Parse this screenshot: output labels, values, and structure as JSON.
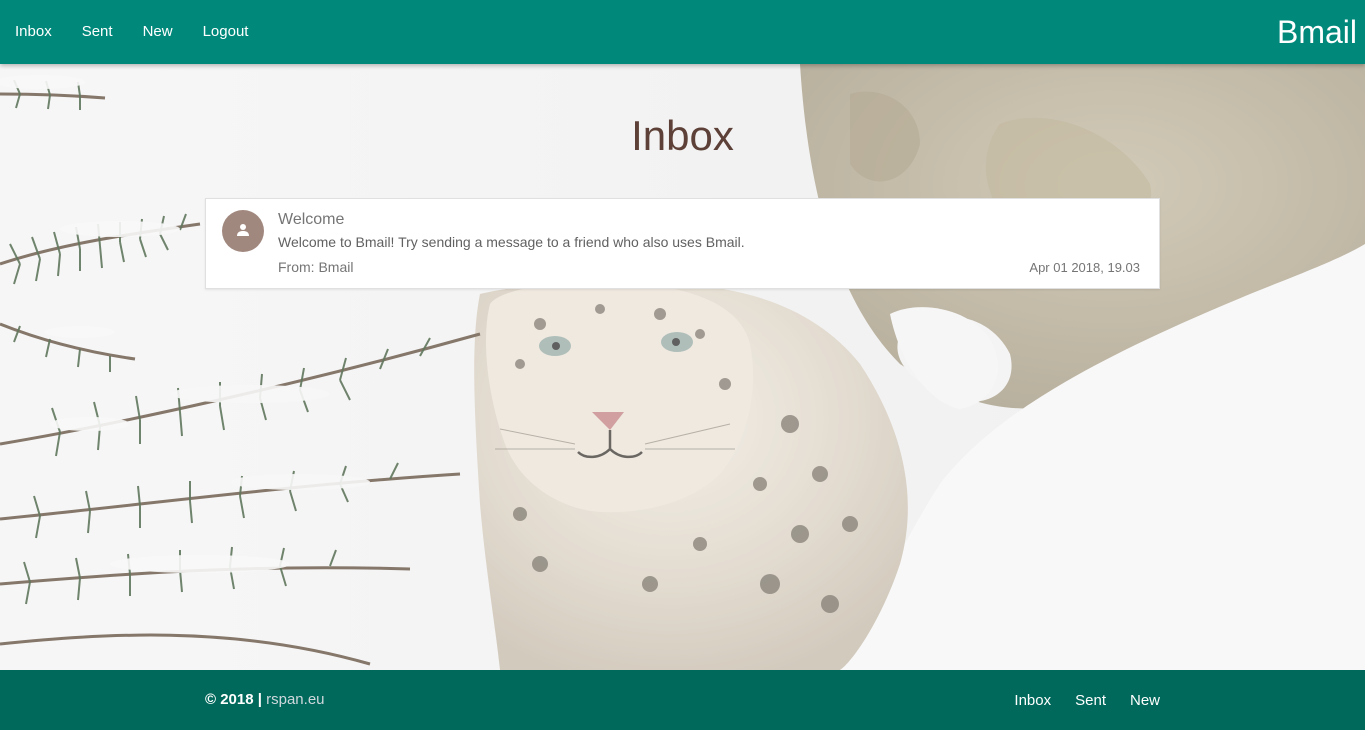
{
  "nav": {
    "links": [
      "Inbox",
      "Sent",
      "New",
      "Logout"
    ],
    "brand": "Bmail"
  },
  "page": {
    "title": "Inbox"
  },
  "messages": [
    {
      "subject": "Welcome",
      "body": "Welcome to Bmail! Try sending a message to a friend who also uses Bmail.",
      "from": "From: Bmail",
      "date": "Apr 01 2018, 19.03",
      "avatar_icon": "person-icon"
    }
  ],
  "footer": {
    "copyright": "© 2018 | ",
    "site": "rspan.eu",
    "links": [
      "Inbox",
      "Sent",
      "New"
    ]
  },
  "colors": {
    "navbar": "#00897b",
    "footer": "#00695c",
    "title": "#5d4037",
    "avatar": "#a1887f"
  }
}
